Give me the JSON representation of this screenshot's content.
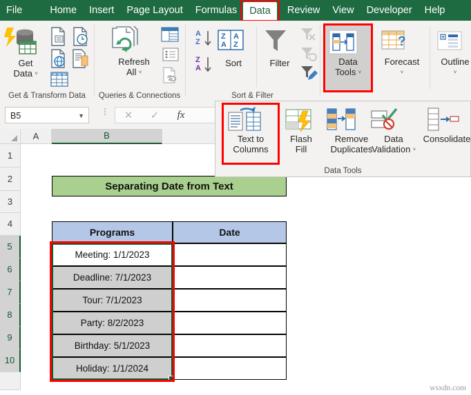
{
  "tabs": [
    {
      "label": "File",
      "active": false
    },
    {
      "label": "Home",
      "active": false
    },
    {
      "label": "Insert",
      "active": false
    },
    {
      "label": "Page Layout",
      "active": false
    },
    {
      "label": "Formulas",
      "active": false
    },
    {
      "label": "Data",
      "active": true
    },
    {
      "label": "Review",
      "active": false
    },
    {
      "label": "View",
      "active": false
    },
    {
      "label": "Developer",
      "active": false
    },
    {
      "label": "Help",
      "active": false
    }
  ],
  "ribbon": {
    "groups": [
      {
        "name": "Get & Transform Data",
        "label": "Get & Transform Data"
      },
      {
        "name": "Queries & Connections",
        "label": "Queries & Connections"
      },
      {
        "name": "Sort & Filter",
        "label": "Sort & Filter"
      },
      {
        "name": "Data Tools",
        "label": "Data Tools"
      }
    ],
    "get_data": {
      "line1": "Get",
      "line2": "Data",
      "chevron": "ⱽ"
    },
    "refresh_all": {
      "line1": "Refresh",
      "line2": "All",
      "chevron": "ⱽ"
    },
    "sort_label": "Sort",
    "filter_label": "Filter",
    "data_tools": {
      "line1": "Data",
      "line2": "Tools",
      "chevron": "ⱽ"
    },
    "forecast": {
      "line1": "Forecast",
      "chevron": "ⱽ"
    },
    "outline": {
      "line1": "Outline",
      "chevron": "ⱽ"
    },
    "text_to_columns": {
      "line1": "Text to",
      "line2": "Columns"
    },
    "flash_fill": {
      "line1": "Flash",
      "line2": "Fill"
    },
    "remove_duplicates": {
      "line1": "Remove",
      "line2": "Duplicates"
    },
    "data_validation": {
      "line1": "Data",
      "line2": "Validation",
      "chevron": "ⱽ"
    },
    "consolidate": {
      "line1": "Consolidate"
    }
  },
  "formula_bar": {
    "name_box_value": "B5",
    "name_box_chevron": "▼",
    "cancel": "✕",
    "enter": "✓",
    "fx": "fx",
    "formula_value": "",
    "formula_placeholder": ""
  },
  "sheet": {
    "columns": [
      {
        "label": "A",
        "selected": false
      },
      {
        "label": "B",
        "selected": true
      }
    ],
    "rows": [
      "1",
      "2",
      "3",
      "4",
      "5",
      "6",
      "7",
      "8",
      "9",
      "10"
    ],
    "selected_rows": [
      "5",
      "6",
      "7",
      "8",
      "9",
      "10"
    ],
    "title": "Separating Date from Text",
    "table_headers": [
      "Programs",
      "Date"
    ],
    "table_rows": [
      {
        "program": "Meeting: 1/1/2023",
        "date": ""
      },
      {
        "program": "Deadline: 7/1/2023",
        "date": ""
      },
      {
        "program": "Tour: 7/1/2023",
        "date": ""
      },
      {
        "program": "Party: 8/2/2023",
        "date": ""
      },
      {
        "program": "Birthday: 5/1/2023",
        "date": ""
      },
      {
        "program": "Holiday: 1/1/2024",
        "date": ""
      }
    ]
  },
  "watermark": "wsxdn.com",
  "colors": {
    "ribbon_green": "#1e6b41",
    "title_fill": "#a9d08e",
    "header_fill": "#b4c7e7",
    "selection_green": "#11592f",
    "highlight_red": "#ff0000",
    "selected_cell_gray": "#cfcfcf"
  }
}
